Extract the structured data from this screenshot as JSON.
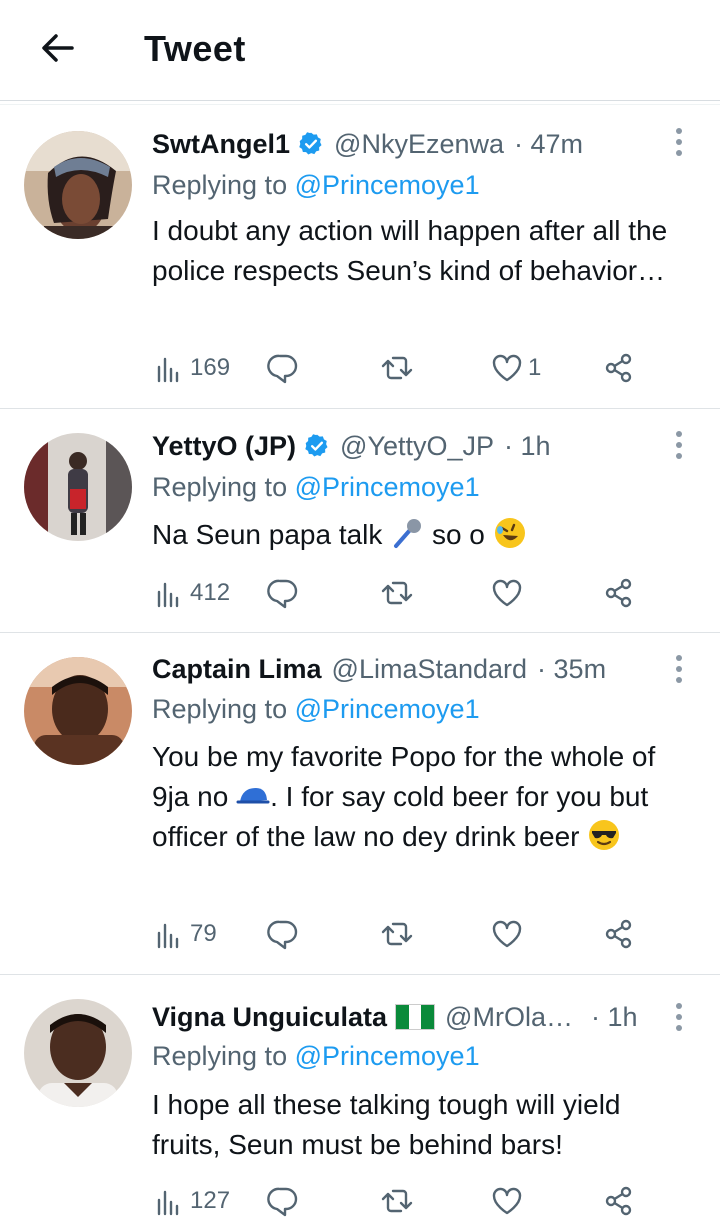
{
  "header": {
    "title": "Tweet",
    "back_icon": "arrow-left-icon"
  },
  "colors": {
    "link": "#1d9bf0",
    "muted": "#536471",
    "text": "#0f1419",
    "verified": "#1d9bf0"
  },
  "tweets": [
    {
      "name": "SwtAngel1",
      "verified": true,
      "handle": "@NkyEzenwa",
      "time": "· 47m",
      "replying_prefix": "Replying to",
      "replying_to": "@Princemoye1",
      "text": "I doubt any action will happen after all the police respects Seun’s kind of behavior…",
      "views": "169",
      "likes": "1"
    },
    {
      "name": "YettyO (JP)",
      "verified": true,
      "handle": "@YettyO_JP",
      "time": "· 1h",
      "replying_prefix": "Replying to",
      "replying_to": "@Princemoye1",
      "text_before": "Na Seun papa talk",
      "text_mid": "so o",
      "views": "412"
    },
    {
      "name": "Captain Lima",
      "handle": "@LimaStandard",
      "time": "· 35m",
      "replying_prefix": "Replying to",
      "replying_to": "@Princemoye1",
      "text_before": "You be my favorite Popo for the whole of 9ja no",
      "text_after": ". I for say cold beer for you but officer of the law no dey drink beer",
      "views": "79"
    },
    {
      "name": "Vigna Unguiculata",
      "flag": "nigeria-flag",
      "handle": "@MrOla…",
      "time": "· 1h",
      "replying_prefix": "Replying to",
      "replying_to": "@Princemoye1",
      "text": "I hope all these talking tough will yield fruits, Seun must be behind bars!",
      "views": "127"
    }
  ]
}
